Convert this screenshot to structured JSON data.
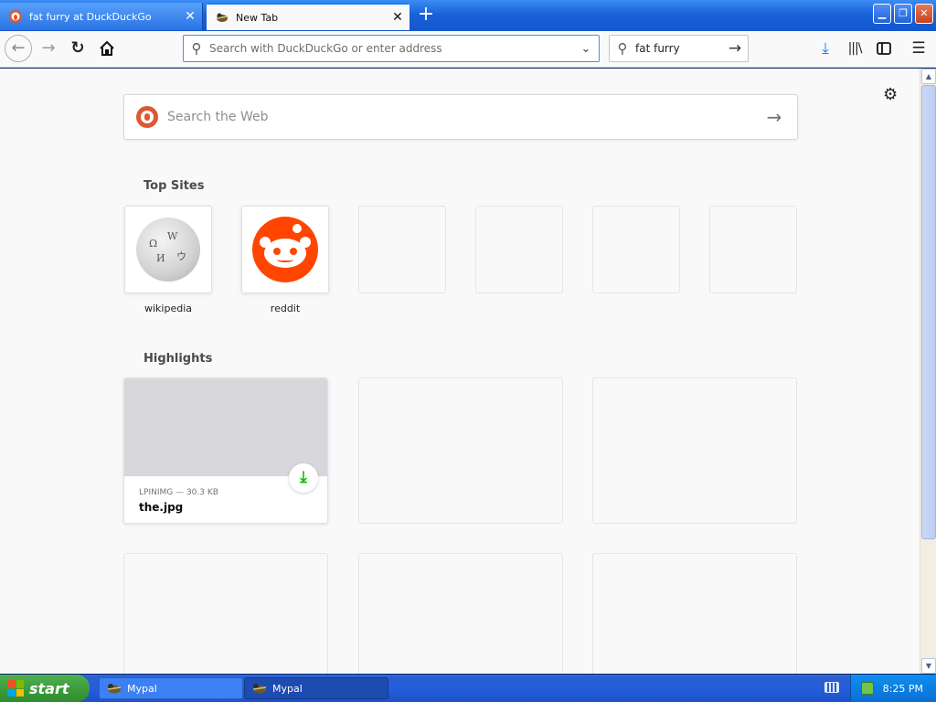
{
  "tabs": [
    {
      "label": "fat furry at DuckDuckGo",
      "favicon": "duckduckgo-icon",
      "active": false
    },
    {
      "label": "New Tab",
      "favicon": "mypal-icon",
      "active": true
    }
  ],
  "window_controls": {
    "minimize": "minimize-icon",
    "maximize": "maximize-icon",
    "close": "close-icon"
  },
  "navbar": {
    "url_placeholder": "Search with DuckDuckGo or enter address",
    "search_value": "fat furry"
  },
  "newtab": {
    "search_placeholder": "Search the Web",
    "top_sites_title": "Top Sites",
    "top_sites": [
      {
        "name": "wikipedia",
        "icon": "wikipedia-globe-icon"
      },
      {
        "name": "reddit",
        "icon": "reddit-icon"
      },
      {
        "name": ""
      },
      {
        "name": ""
      },
      {
        "name": ""
      },
      {
        "name": ""
      }
    ],
    "highlights_title": "Highlights",
    "highlights": [
      {
        "meta": "LPINIMG — 30.3 KB",
        "title": "the.jpg",
        "icon": "download-icon"
      }
    ]
  },
  "taskbar": {
    "start_label": "start",
    "tasks": [
      {
        "label": "Mypal",
        "active": false
      },
      {
        "label": "Mypal",
        "active": true
      }
    ],
    "clock": "8:25 PM"
  },
  "colors": {
    "accent": "#0a84ff",
    "reddit": "#ff4500",
    "duckduckgo": "#de5833",
    "download_green": "#12bc00",
    "xp_taskbar": "#245edb",
    "xp_start": "#3c9a3c"
  }
}
